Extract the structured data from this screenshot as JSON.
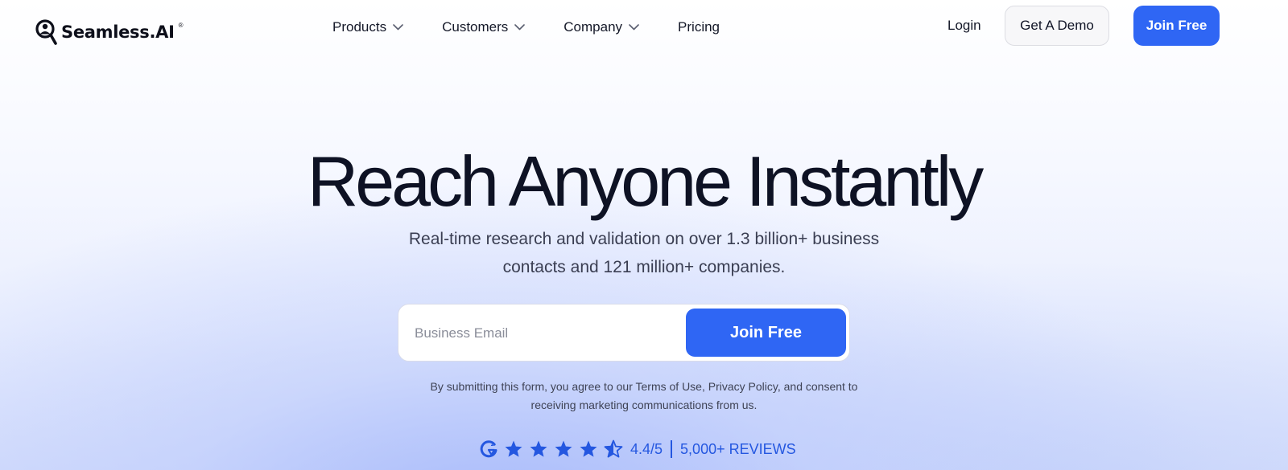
{
  "brand": {
    "name": "Seamless.AI",
    "registered_mark": "®",
    "logo_icon": "magnifier-person-icon"
  },
  "nav": {
    "menu": [
      {
        "label": "Products",
        "has_dropdown": true
      },
      {
        "label": "Customers",
        "has_dropdown": true
      },
      {
        "label": "Company",
        "has_dropdown": true
      },
      {
        "label": "Pricing",
        "has_dropdown": false
      }
    ],
    "login_label": "Login",
    "demo_label": "Get A Demo",
    "join_label": "Join Free"
  },
  "hero": {
    "title": "Reach Anyone Instantly",
    "subtitle_line1": "Real-time research and validation on over 1.3 billion+ business",
    "subtitle_line2": "contacts and 121 million+ companies."
  },
  "form": {
    "email_placeholder": "Business Email",
    "email_value": "",
    "submit_label": "Join Free"
  },
  "disclaimer": {
    "prefix": "By submitting this form, you agree to our ",
    "terms": "Terms of Use",
    "comma": ", ",
    "privacy": "Privacy Policy",
    "suffix_line1": ", and consent to",
    "line2": "receiving marketing communications from us."
  },
  "rating": {
    "badge_icon": "g2-icon",
    "stars_full": 4,
    "stars_half": 1,
    "score": "4.4/5",
    "reviews": "5,000+ REVIEWS"
  },
  "colors": {
    "accent": "#2f66f4",
    "rating_blue": "#2457e0",
    "text_dark": "#0e1224"
  }
}
